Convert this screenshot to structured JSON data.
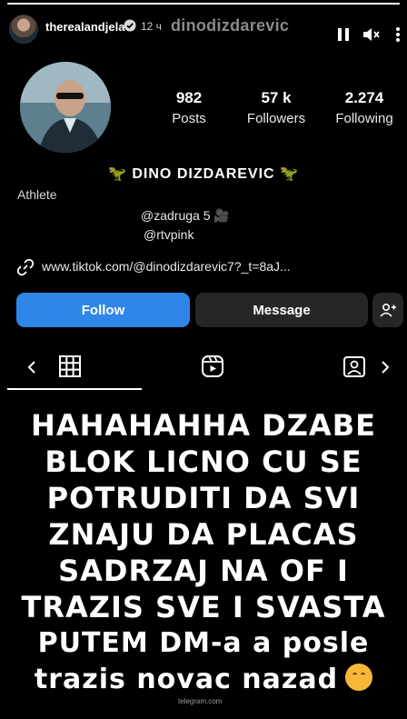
{
  "story": {
    "username": "therealandjela",
    "time": "12 ч",
    "watermark_top": "dinodizdarevic",
    "progress": 1.0
  },
  "profile": {
    "stats": [
      {
        "value": "982",
        "label": "Posts"
      },
      {
        "value": "57 k",
        "label": "Followers"
      },
      {
        "value": "2.274",
        "label": "Following"
      }
    ],
    "display_name": "DINO DIZDAREVIC",
    "category": "Athlete",
    "bio_line1": "@zadruga 5 🎥",
    "bio_line2": "@rtvpink",
    "link": "www.tiktok.com/@dinodizdarevic7?_t=8aJ..."
  },
  "actions": {
    "follow": "Follow",
    "message": "Message"
  },
  "overlay": {
    "lines": [
      "HAHAHAHHA DZABE",
      "BLOK LICNO CU SE",
      "POTRUDITI DA SVI",
      "ZNAJU DA PLACAS",
      "SADRZAJ NA OF I",
      "TRAZIS SVE I SVASTA",
      "PUTEM DM-a a posle",
      "trazis novac nazad"
    ]
  },
  "watermark_bottom": "telegram.com",
  "colors": {
    "accent": "#2f86e8",
    "secondary_button": "#262626",
    "background": "#000000"
  }
}
